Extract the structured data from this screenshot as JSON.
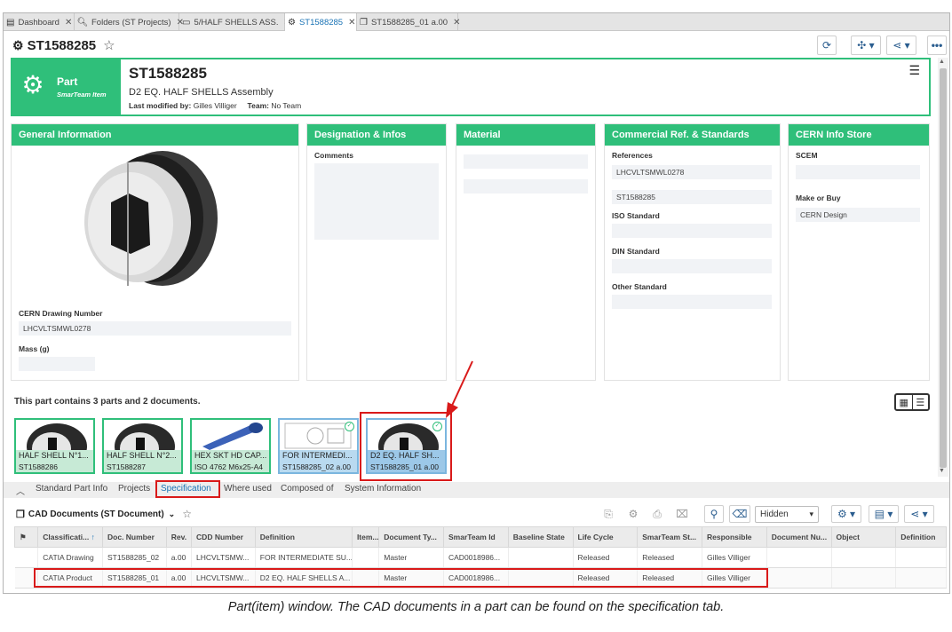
{
  "tabs": [
    {
      "label": "Dashboard",
      "icon": "dashboard-icon"
    },
    {
      "label": "Folders (ST Projects)",
      "icon": "search-icon"
    },
    {
      "label": "5/HALF SHELLS ASS.",
      "icon": "folder-icon"
    },
    {
      "label": "ST1588285",
      "icon": "gear-icon",
      "active": true
    },
    {
      "label": "ST1588285_01 a.00",
      "icon": "copy-icon"
    }
  ],
  "header": {
    "title": "ST1588285"
  },
  "part": {
    "kind": "Part",
    "kind_sub": "SmarTeam Item",
    "id": "ST1588285",
    "description": "D2 EQ. HALF SHELLS Assembly",
    "modified_label": "Last modified by:",
    "modified_by": "Gilles Villiger",
    "team_label": "Team:",
    "team": "No Team"
  },
  "panels": {
    "general": {
      "title": "General Information",
      "drawing_label": "CERN Drawing Number",
      "drawing_value": "LHCVLTSMWL0278",
      "mass_label": "Mass (g)"
    },
    "designation": {
      "title": "Designation & Infos",
      "comments_label": "Comments"
    },
    "material": {
      "title": "Material"
    },
    "commercial": {
      "title": "Commercial Ref. & Standards",
      "references_label": "References",
      "ref1": "LHCVLTSMWL0278",
      "ref2": "ST1588285",
      "iso_label": "ISO Standard",
      "din_label": "DIN Standard",
      "other_label": "Other Standard"
    },
    "cern": {
      "title": "CERN Info Store",
      "scem_label": "SCEM",
      "make_label": "Make or Buy",
      "make_value": "CERN Design"
    }
  },
  "contains": "This part contains 3 parts and 2 documents.",
  "thumbnails": [
    {
      "line1": "HALF SHELL N°1...",
      "line2": "ST1588286",
      "type": "part"
    },
    {
      "line1": "HALF SHELL N°2...",
      "line2": "ST1588287",
      "type": "part"
    },
    {
      "line1": "HEX SKT HD CAP...",
      "line2": "ISO 4762 M6x25-A4",
      "type": "part"
    },
    {
      "line1": "FOR INTERMEDI...",
      "line2": "ST1588285_02 a.00",
      "type": "doc"
    },
    {
      "line1": "D2 EQ. HALF SH...",
      "line2": "ST1588285_01 a.00",
      "type": "doc"
    }
  ],
  "subtabs": [
    "Standard Part Info",
    "Projects",
    "Specification",
    "Where used",
    "Composed of",
    "System Information"
  ],
  "docs": {
    "title": "CAD Documents (ST Document)",
    "filter": "Hidden",
    "columns": [
      "Classificati...",
      "Doc. Number",
      "Rev.",
      "CDD Number",
      "Definition",
      "Item...",
      "Document Ty...",
      "SmarTeam Id",
      "Baseline State",
      "Life Cycle",
      "SmarTeam St...",
      "Responsible",
      "Document Nu...",
      "Object",
      "Definition"
    ],
    "rows": [
      [
        "CATIA Drawing",
        "ST1588285_02",
        "a.00",
        "LHCVLTSMW...",
        "FOR INTERMEDIATE SU...",
        "",
        "Master",
        "CAD0018986...",
        "",
        "Released",
        "Released",
        "Gilles Villiger",
        "",
        "",
        ""
      ],
      [
        "CATIA Product",
        "ST1588285_01",
        "a.00",
        "LHCVLTSMW...",
        "D2 EQ. HALF SHELLS A...",
        "",
        "Master",
        "CAD0018986...",
        "",
        "Released",
        "Released",
        "Gilles Villiger",
        "",
        "",
        ""
      ]
    ]
  },
  "caption": "Part(item) window. The CAD documents in a part can be found on the specification tab.",
  "colors": {
    "accent_green": "#2fbf7a",
    "highlight_red": "#d91a1a",
    "link_blue": "#1a73b5"
  }
}
